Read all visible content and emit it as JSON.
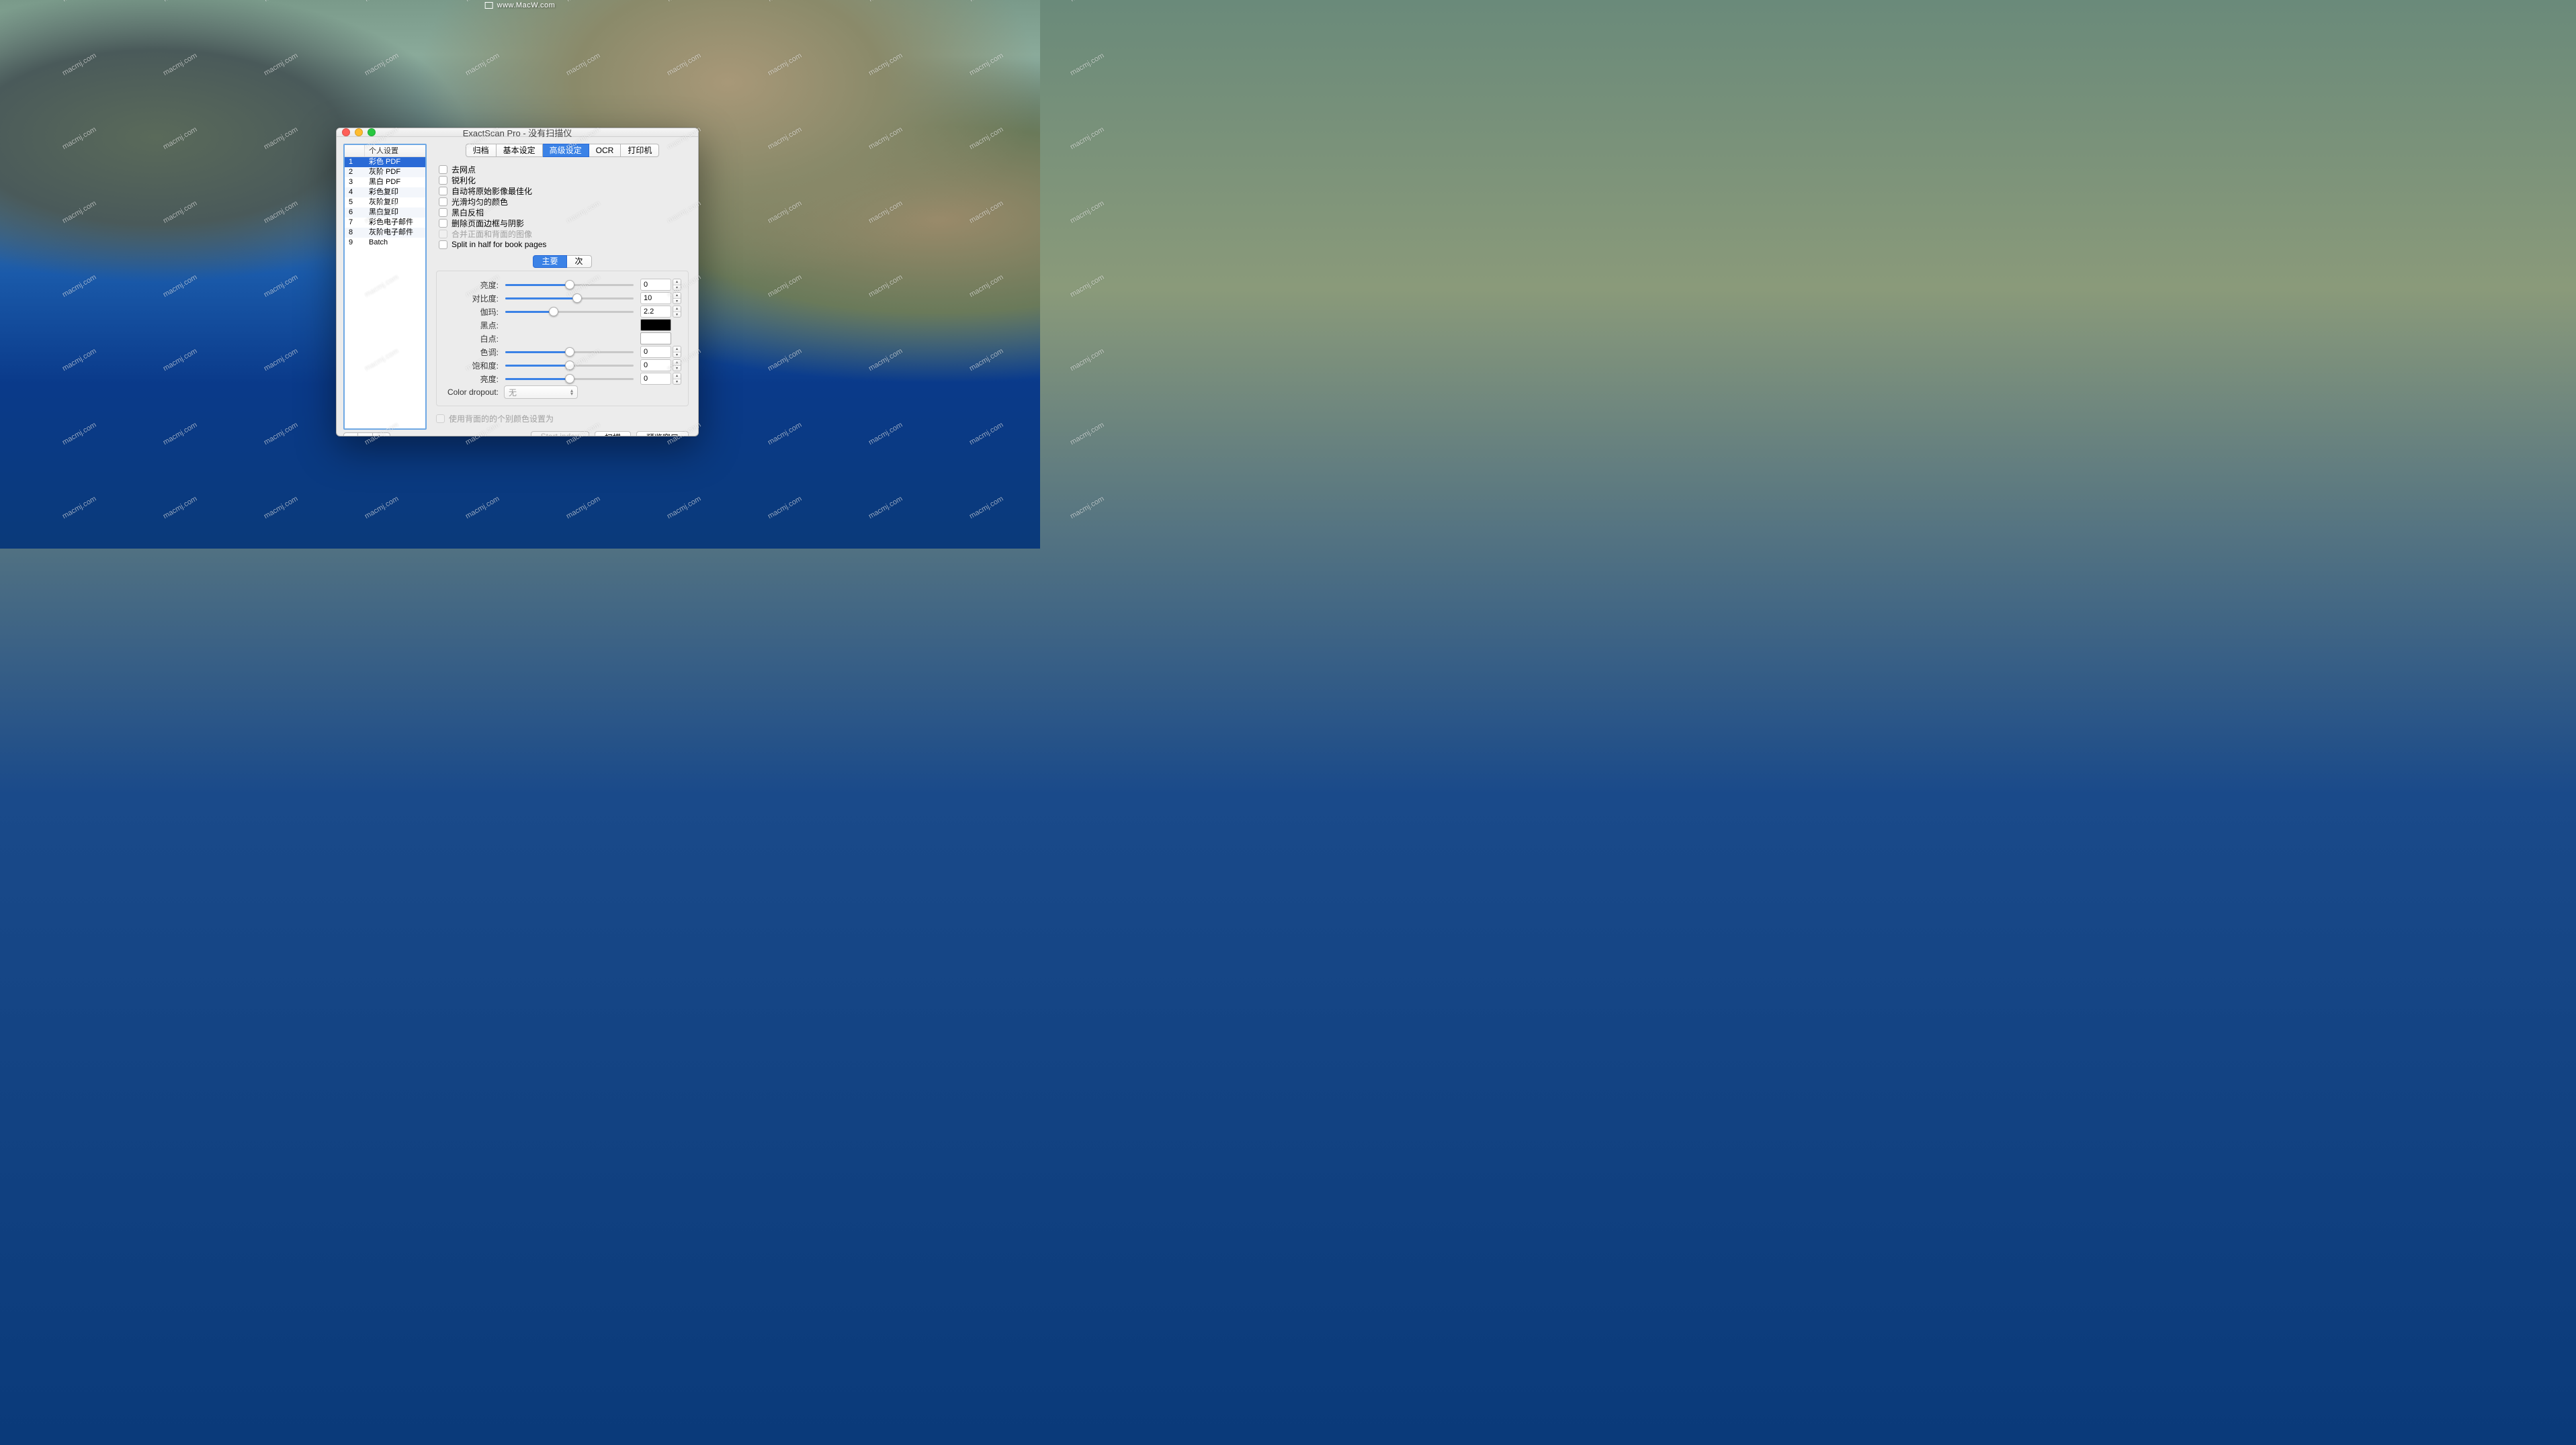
{
  "watermark_top": "www.MacW.com",
  "watermark_text": "macmj.com",
  "window": {
    "title": "ExactScan Pro - 没有扫描仪"
  },
  "sidebar": {
    "header_num": "",
    "header_name": "个人设置",
    "items": [
      {
        "num": "1",
        "name": "彩色 PDF",
        "selected": true
      },
      {
        "num": "2",
        "name": "灰阶 PDF"
      },
      {
        "num": "3",
        "name": "黑白 PDF"
      },
      {
        "num": "4",
        "name": "彩色复印"
      },
      {
        "num": "5",
        "name": "灰阶复印"
      },
      {
        "num": "6",
        "name": "黑白复印"
      },
      {
        "num": "7",
        "name": "彩色电子邮件"
      },
      {
        "num": "8",
        "name": "灰阶电子邮件"
      },
      {
        "num": "9",
        "name": "Batch"
      }
    ],
    "buttons": {
      "add": "+",
      "remove": "−",
      "gear": "✻▾"
    }
  },
  "tabs": [
    {
      "label": "归档"
    },
    {
      "label": "基本设定"
    },
    {
      "label": "高级设定",
      "active": true
    },
    {
      "label": "OCR"
    },
    {
      "label": "打印机"
    }
  ],
  "checkboxes": [
    {
      "label": "去网点"
    },
    {
      "label": "锐利化"
    },
    {
      "label": "自动将原始影像最佳化"
    },
    {
      "label": "光滑均匀的颜色"
    },
    {
      "label": "黑白反相"
    },
    {
      "label": "删除页面边框与阴影"
    },
    {
      "label": "合并正面和背面的图像",
      "disabled": true
    },
    {
      "label": "Split in half for book pages"
    }
  ],
  "subtabs": [
    {
      "label": "主要",
      "active": true
    },
    {
      "label": "次"
    }
  ],
  "sliders": [
    {
      "key": "brightness",
      "label": "亮度:",
      "value": "0",
      "pct": 50
    },
    {
      "key": "contrast",
      "label": "对比度:",
      "value": "10",
      "pct": 56
    },
    {
      "key": "gamma",
      "label": "伽玛:",
      "value": "2.2",
      "pct": 38
    },
    {
      "key": "black",
      "label": "黑点:",
      "swatch": "#000000"
    },
    {
      "key": "white",
      "label": "白点:",
      "swatch": "#ffffff"
    },
    {
      "key": "hue",
      "label": "色调:",
      "value": "0",
      "pct": 50
    },
    {
      "key": "saturation",
      "label": "饱和度:",
      "value": "0",
      "pct": 50
    },
    {
      "key": "lightness",
      "label": "亮度:",
      "value": "0",
      "pct": 50
    }
  ],
  "color_dropout": {
    "label": "Color dropout:",
    "value": "无"
  },
  "use_back_label": "使用背面的的个别颜色设置为",
  "footer": {
    "start_index": "Start index",
    "scan": "扫描",
    "preview": "预览窗口"
  }
}
